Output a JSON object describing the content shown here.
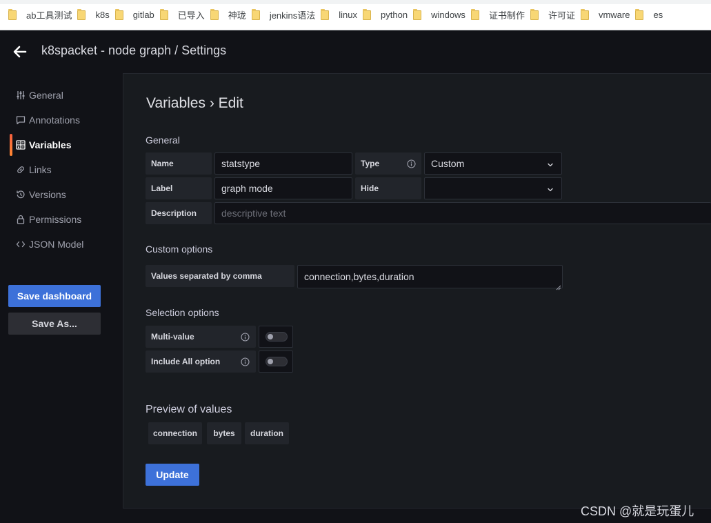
{
  "bookmarks": [
    {
      "label": "ab工具测试",
      "icon": "folder-icon"
    },
    {
      "label": "k8s",
      "icon": "folder-icon"
    },
    {
      "label": "gitlab",
      "icon": "folder-icon"
    },
    {
      "label": "已导入",
      "icon": "folder-icon"
    },
    {
      "label": "神珑",
      "icon": "folder-icon"
    },
    {
      "label": "jenkins语法",
      "icon": "folder-icon"
    },
    {
      "label": "linux",
      "icon": "folder-icon"
    },
    {
      "label": "python",
      "icon": "folder-icon"
    },
    {
      "label": "windows",
      "icon": "folder-icon"
    },
    {
      "label": "证书制作",
      "icon": "folder-icon"
    },
    {
      "label": "许可证",
      "icon": "folder-icon"
    },
    {
      "label": "vmware",
      "icon": "folder-icon"
    },
    {
      "label": "es",
      "icon": "folder-icon"
    }
  ],
  "header": {
    "title": "k8spacket - node graph / Settings"
  },
  "sidebar": {
    "items": [
      {
        "label": "General",
        "icon": "sliders-icon",
        "active": false
      },
      {
        "label": "Annotations",
        "icon": "comment-icon",
        "active": false
      },
      {
        "label": "Variables",
        "icon": "calculator-icon",
        "active": true
      },
      {
        "label": "Links",
        "icon": "link-icon",
        "active": false
      },
      {
        "label": "Versions",
        "icon": "history-icon",
        "active": false
      },
      {
        "label": "Permissions",
        "icon": "lock-icon",
        "active": false
      },
      {
        "label": "JSON Model",
        "icon": "brackets-icon",
        "active": false
      }
    ],
    "save_label": "Save dashboard",
    "save_as_label": "Save As..."
  },
  "editor": {
    "title": "Variables › Edit",
    "general": {
      "heading": "General",
      "name_label": "Name",
      "name_value": "statstype",
      "type_label": "Type",
      "type_value": "Custom",
      "label_label": "Label",
      "label_value": "graph mode",
      "hide_label": "Hide",
      "hide_value": "",
      "description_label": "Description",
      "description_placeholder": "descriptive text"
    },
    "custom": {
      "heading": "Custom options",
      "values_label": "Values separated by comma",
      "values_value": "connection,bytes,duration"
    },
    "selection": {
      "heading": "Selection options",
      "multi_label": "Multi-value",
      "multi_on": false,
      "include_all_label": "Include All option",
      "include_all_on": false
    },
    "preview": {
      "heading": "Preview of values",
      "values": [
        "connection",
        "bytes",
        "duration"
      ]
    },
    "update_label": "Update"
  },
  "watermark": "CSDN @就是玩蛋儿",
  "colors": {
    "background": "#111217",
    "panel": "#181b1f",
    "primary": "#3d71d9",
    "active_accent": "#ff7433"
  }
}
